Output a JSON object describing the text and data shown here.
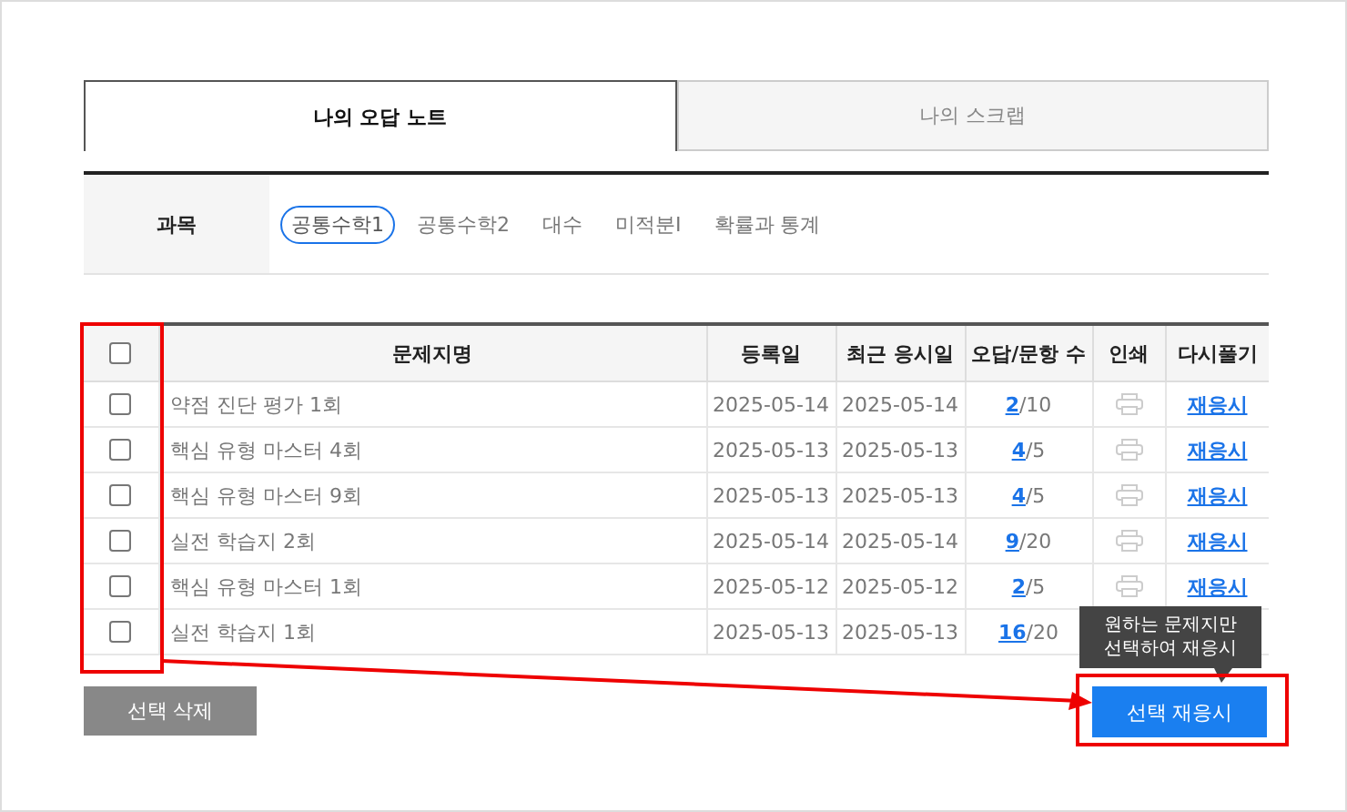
{
  "tabs": [
    {
      "label": "나의 오답 노트",
      "selected": true
    },
    {
      "label": "나의 스크랩",
      "selected": false
    }
  ],
  "subject_filter": {
    "label": "과목",
    "options": [
      {
        "label": "공통수학1",
        "selected": true
      },
      {
        "label": "공통수학2",
        "selected": false
      },
      {
        "label": "대수",
        "selected": false
      },
      {
        "label": "미적분I",
        "selected": false
      },
      {
        "label": "확률과 통계",
        "selected": false
      }
    ]
  },
  "table": {
    "select_all_checked": false,
    "columns": [
      "문제지명",
      "등록일",
      "최근 응시일",
      "오답/문항 수",
      "인쇄",
      "다시풀기"
    ],
    "rows": [
      {
        "checked": false,
        "title": "약점 진단 평가 1회",
        "registered": "2025-05-14",
        "last_taken": "2025-05-14",
        "wrong": "2",
        "total": "/10",
        "print": true,
        "retry": "재응시"
      },
      {
        "checked": false,
        "title": "핵심 유형 마스터 4회",
        "registered": "2025-05-13",
        "last_taken": "2025-05-13",
        "wrong": "4",
        "total": "/5",
        "print": true,
        "retry": "재응시"
      },
      {
        "checked": false,
        "title": "핵심 유형 마스터 9회",
        "registered": "2025-05-13",
        "last_taken": "2025-05-13",
        "wrong": "4",
        "total": "/5",
        "print": true,
        "retry": "재응시"
      },
      {
        "checked": false,
        "title": "실전 학습지 2회",
        "registered": "2025-05-14",
        "last_taken": "2025-05-14",
        "wrong": "9",
        "total": "/20",
        "print": true,
        "retry": "재응시"
      },
      {
        "checked": false,
        "title": "핵심 유형 마스터 1회",
        "registered": "2025-05-12",
        "last_taken": "2025-05-12",
        "wrong": "2",
        "total": "/5",
        "print": true,
        "retry": "재응시"
      },
      {
        "checked": false,
        "title": "실전 학습지 1회",
        "registered": "2025-05-13",
        "last_taken": "2025-05-13",
        "wrong": "16",
        "total": "/20"
      }
    ]
  },
  "buttons": {
    "delete": "선택 삭제",
    "retry_selected": "선택 재응시"
  },
  "tooltip": "원하는 문제지만\n선택하여 재응시"
}
